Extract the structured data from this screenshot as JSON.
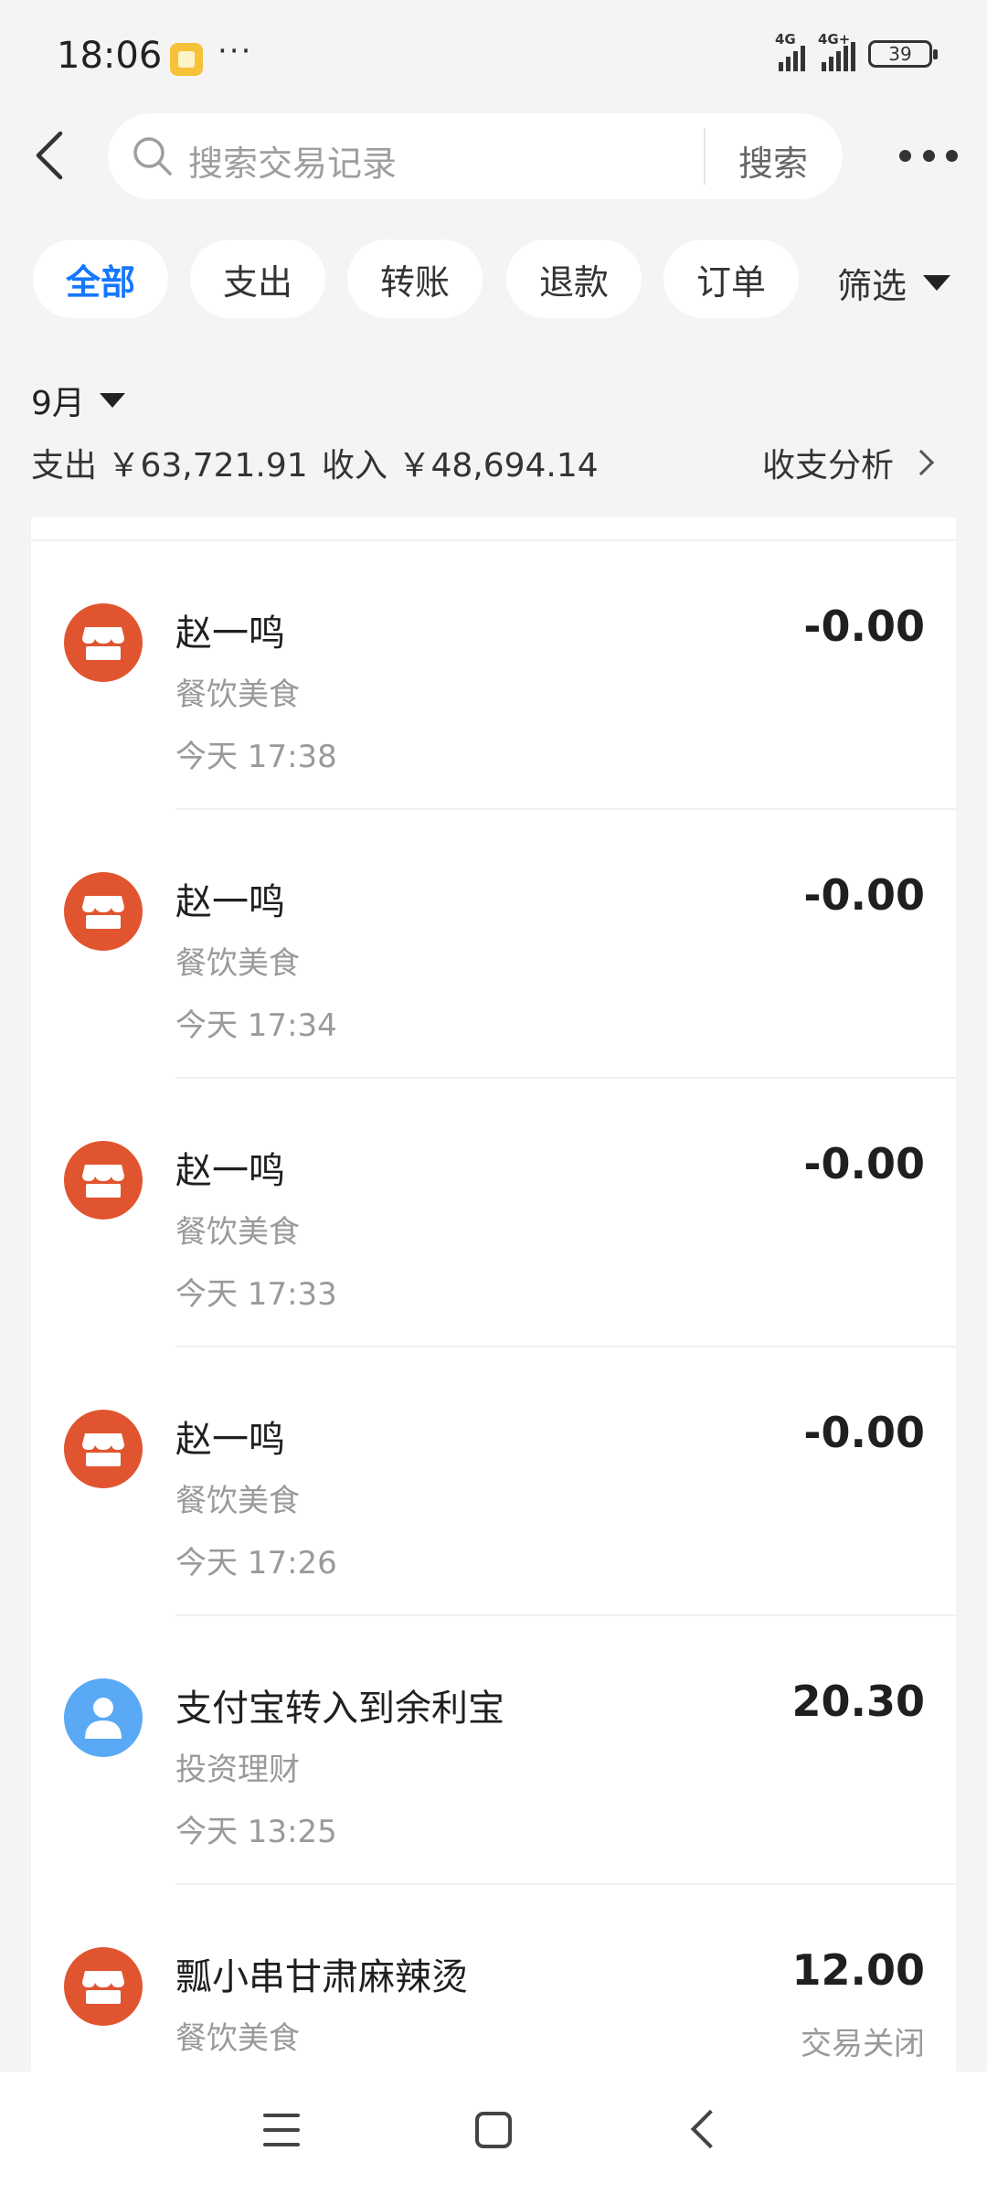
{
  "status_bar": {
    "time": "18:06",
    "more": "···",
    "signal1_label": "4G",
    "signal2_label": "4G+",
    "battery": "39"
  },
  "search": {
    "placeholder": "搜索交易记录",
    "button_label": "搜索"
  },
  "tabs": [
    {
      "label": "全部",
      "active": true
    },
    {
      "label": "支出",
      "active": false
    },
    {
      "label": "转账",
      "active": false
    },
    {
      "label": "退款",
      "active": false
    },
    {
      "label": "订单",
      "active": false
    }
  ],
  "filter_label": "筛选",
  "summary": {
    "month": "9月",
    "expense": "支出 ￥63,721.91",
    "income": "收入 ￥48,694.14",
    "analysis_label": "收支分析"
  },
  "transactions": [
    {
      "icon": "shop",
      "title": "赵一鸣",
      "category": "餐饮美食",
      "time": "今天 17:38",
      "amount": "-0.00",
      "status": ""
    },
    {
      "icon": "shop",
      "title": "赵一鸣",
      "category": "餐饮美食",
      "time": "今天 17:34",
      "amount": "-0.00",
      "status": ""
    },
    {
      "icon": "shop",
      "title": "赵一鸣",
      "category": "餐饮美食",
      "time": "今天 17:33",
      "amount": "-0.00",
      "status": ""
    },
    {
      "icon": "shop",
      "title": "赵一鸣",
      "category": "餐饮美食",
      "time": "今天 17:26",
      "amount": "-0.00",
      "status": ""
    },
    {
      "icon": "person",
      "title": "支付宝转入到余利宝",
      "category": "投资理财",
      "time": "今天 13:25",
      "amount": "20.30",
      "status": ""
    },
    {
      "icon": "shop",
      "title": "瓢小串甘肃麻辣烫",
      "category": "餐饮美食",
      "time": "",
      "amount": "12.00",
      "status": "交易关闭"
    }
  ],
  "colors": {
    "accent": "#1677ff",
    "shop_icon": "#e0552f",
    "person_icon": "#5aa9f5",
    "background": "#f4f4f4"
  }
}
